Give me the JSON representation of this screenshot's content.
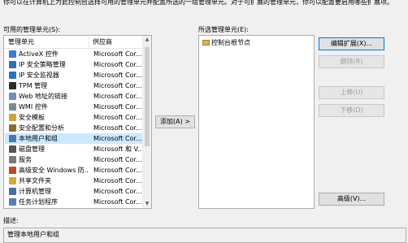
{
  "intro_text": "你可以在计算机上为此控制台选择可用的管理单元并配置所选的一组管理单元。对于可扩展的管理单元，你可以配置要启用哪些扩展项。",
  "available": {
    "label": "可用的管理单元(S):",
    "columns": [
      "管理单元",
      "供应商"
    ],
    "rows": [
      {
        "name": "ActiveX 控件",
        "vendor": "Microsoft Cor...",
        "icon": "activex-icon",
        "color": "#3a7bd5"
      },
      {
        "name": "IP 安全策略管理",
        "vendor": "Microsoft Cor...",
        "icon": "ip-security-policy-icon",
        "color": "#2f6fb7"
      },
      {
        "name": "IP 安全监视器",
        "vendor": "Microsoft Cor...",
        "icon": "ip-security-monitor-icon",
        "color": "#2f6fb7"
      },
      {
        "name": "TPM 管理",
        "vendor": "Microsoft Cor...",
        "icon": "tpm-icon",
        "color": "#2b2b2b"
      },
      {
        "name": "Web 地址的链接",
        "vendor": "Microsoft Cor...",
        "icon": "web-link-icon",
        "color": "#6f8fb5"
      },
      {
        "name": "WMI 控件",
        "vendor": "Microsoft Cor...",
        "icon": "wmi-icon",
        "color": "#7a8a9a"
      },
      {
        "name": "安全模板",
        "vendor": "Microsoft Cor...",
        "icon": "security-template-icon",
        "color": "#c9a43a"
      },
      {
        "name": "安全配置和分析",
        "vendor": "Microsoft Cor...",
        "icon": "security-config-icon",
        "color": "#8a6d2f"
      },
      {
        "name": "本地用户和组",
        "vendor": "Microsoft Cor...",
        "icon": "local-users-icon",
        "color": "#4a78b5",
        "selected": true
      },
      {
        "name": "磁盘管理",
        "vendor": "Microsoft 和 V...",
        "icon": "disk-management-icon",
        "color": "#555555"
      },
      {
        "name": "服务",
        "vendor": "Microsoft Cor...",
        "icon": "services-icon",
        "color": "#7a7a7a"
      },
      {
        "name": "高级安全 Windows 防...",
        "vendor": "Microsoft Cor...",
        "icon": "firewall-icon",
        "color": "#b84a2e"
      },
      {
        "name": "共享文件夹",
        "vendor": "Microsoft Cor...",
        "icon": "shared-folder-icon",
        "color": "#d4a93b"
      },
      {
        "name": "计算机管理",
        "vendor": "Microsoft Cor...",
        "icon": "computer-management-icon",
        "color": "#4a6f9a"
      },
      {
        "name": "任务计划程序",
        "vendor": "Microsoft Cor...",
        "icon": "task-scheduler-icon",
        "color": "#5b7fa6"
      }
    ]
  },
  "add_button": "添加(A) >",
  "selected": {
    "label": "所选管理单元(E):",
    "node": "控制台根节点"
  },
  "buttons": {
    "edit_extensions": "编辑扩展(X)...",
    "remove": "删除(R)",
    "move_up": "上移(U)",
    "move_down": "下移(D)",
    "advanced": "高级(V)..."
  },
  "description": {
    "label": "描述:",
    "text": "管理本地用户和组"
  }
}
